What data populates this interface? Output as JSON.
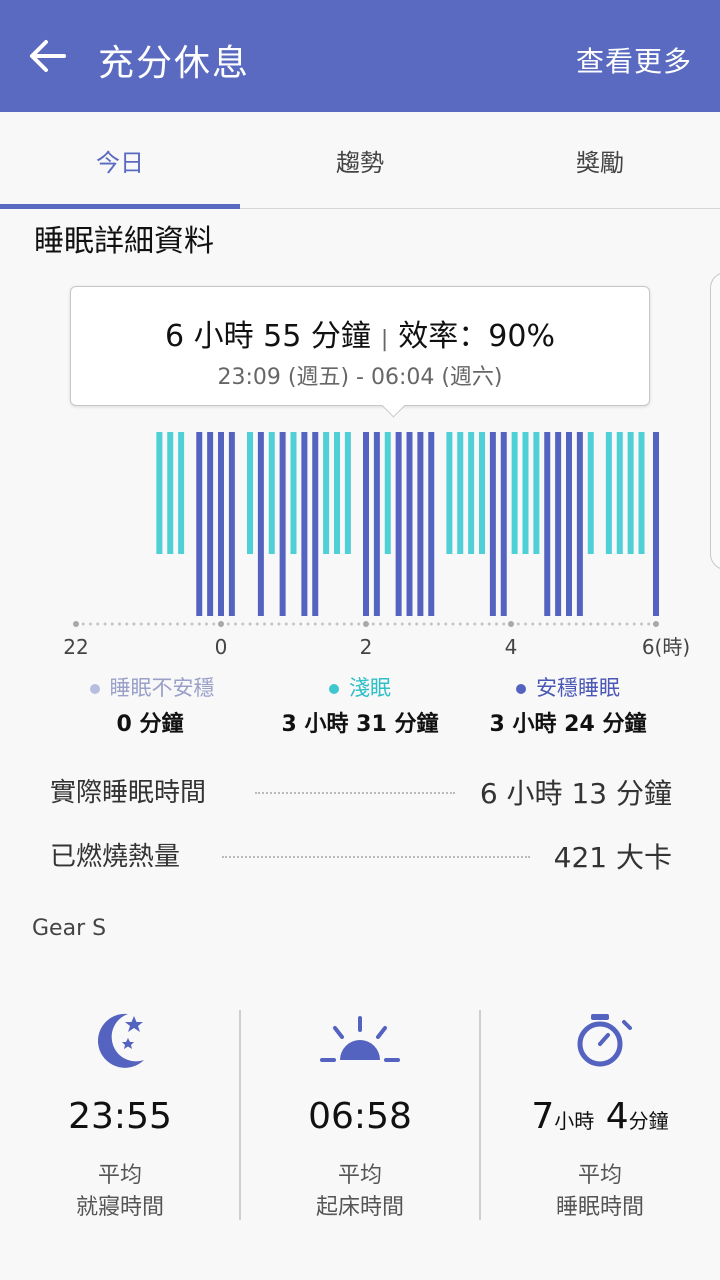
{
  "appbar": {
    "title": "充分休息",
    "more_label": "查看更多"
  },
  "tabs": [
    {
      "label": "今日",
      "active": true
    },
    {
      "label": "趨勢",
      "active": false
    },
    {
      "label": "獎勵",
      "active": false
    }
  ],
  "section_title": "睡眠詳細資料",
  "summary": {
    "duration": "6 小時 55 分鐘",
    "separator": "|",
    "efficiency": "效率：90%",
    "range": "23:09 (週五) - 06:04 (週六)"
  },
  "chart_data": {
    "type": "bar",
    "title": "",
    "x_range_hours": [
      -2,
      6
    ],
    "tick_labels": [
      "22",
      "0",
      "2",
      "4",
      "6(時)"
    ],
    "tick_hours": [
      -2,
      0,
      2,
      4,
      6
    ],
    "series": [
      {
        "name": "淺眠",
        "color": "#4fcfd6",
        "level": "upper"
      },
      {
        "name": "安穩睡眠",
        "color": "#5563c0",
        "level": "lower"
      }
    ],
    "bars": [
      {
        "t": -0.85,
        "stage": "light"
      },
      {
        "t": -0.7,
        "stage": "light"
      },
      {
        "t": -0.55,
        "stage": "light"
      },
      {
        "t": -0.3,
        "stage": "deep"
      },
      {
        "t": -0.15,
        "stage": "deep"
      },
      {
        "t": 0.0,
        "stage": "deep"
      },
      {
        "t": 0.15,
        "stage": "deep"
      },
      {
        "t": 0.4,
        "stage": "light"
      },
      {
        "t": 0.55,
        "stage": "deep"
      },
      {
        "t": 0.7,
        "stage": "light"
      },
      {
        "t": 0.85,
        "stage": "deep"
      },
      {
        "t": 1.0,
        "stage": "light"
      },
      {
        "t": 1.15,
        "stage": "deep"
      },
      {
        "t": 1.3,
        "stage": "deep"
      },
      {
        "t": 1.45,
        "stage": "light"
      },
      {
        "t": 1.6,
        "stage": "light"
      },
      {
        "t": 1.75,
        "stage": "light"
      },
      {
        "t": 2.0,
        "stage": "deep"
      },
      {
        "t": 2.15,
        "stage": "deep"
      },
      {
        "t": 2.3,
        "stage": "light"
      },
      {
        "t": 2.45,
        "stage": "deep"
      },
      {
        "t": 2.6,
        "stage": "deep"
      },
      {
        "t": 2.75,
        "stage": "deep"
      },
      {
        "t": 2.9,
        "stage": "deep"
      },
      {
        "t": 3.15,
        "stage": "light"
      },
      {
        "t": 3.3,
        "stage": "light"
      },
      {
        "t": 3.45,
        "stage": "light"
      },
      {
        "t": 3.6,
        "stage": "light"
      },
      {
        "t": 3.75,
        "stage": "deep"
      },
      {
        "t": 3.9,
        "stage": "deep"
      },
      {
        "t": 4.05,
        "stage": "light"
      },
      {
        "t": 4.2,
        "stage": "light"
      },
      {
        "t": 4.35,
        "stage": "light"
      },
      {
        "t": 4.5,
        "stage": "deep"
      },
      {
        "t": 4.65,
        "stage": "deep"
      },
      {
        "t": 4.8,
        "stage": "deep"
      },
      {
        "t": 4.95,
        "stage": "deep"
      },
      {
        "t": 5.1,
        "stage": "light"
      },
      {
        "t": 5.35,
        "stage": "light"
      },
      {
        "t": 5.5,
        "stage": "light"
      },
      {
        "t": 5.65,
        "stage": "light"
      },
      {
        "t": 5.8,
        "stage": "light"
      },
      {
        "t": 6.0,
        "stage": "deep"
      }
    ]
  },
  "legend": [
    {
      "label": "睡眠不安穩",
      "value": "0 分鐘",
      "color": "#b7bde0"
    },
    {
      "label": "淺眠",
      "value": "3 小時 31 分鐘",
      "color": "#3fc7cf"
    },
    {
      "label": "安穩睡眠",
      "value": "3 小時 24 分鐘",
      "color": "#5563c0"
    }
  ],
  "stats": [
    {
      "label": "實際睡眠時間",
      "value": "6 小時 13 分鐘"
    },
    {
      "label": "已燃燒熱量",
      "value": "421 大卡"
    }
  ],
  "device": "Gear S",
  "averages": [
    {
      "icon": "moon-stars-icon",
      "value": "23:55",
      "caption1": "平均",
      "caption2": "就寢時間"
    },
    {
      "icon": "sunrise-icon",
      "value": "06:58",
      "caption1": "平均",
      "caption2": "起床時間"
    },
    {
      "icon": "stopwatch-icon",
      "value_num1": "7",
      "value_unit1": "小時",
      "value_num2": "4",
      "value_unit2": "分鐘",
      "caption1": "平均",
      "caption2": "睡眠時間"
    }
  ],
  "colors": {
    "accent": "#5b6ac1",
    "light_sleep": "#4fcfd6",
    "deep_sleep": "#5563c0"
  }
}
